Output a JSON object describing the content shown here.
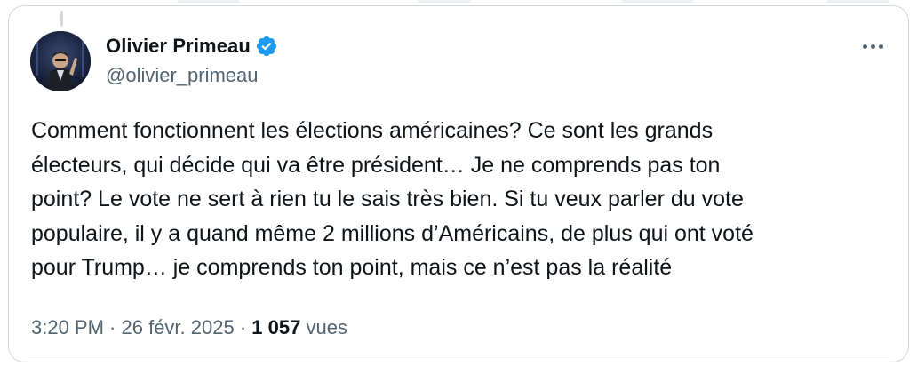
{
  "tweet": {
    "author": {
      "display_name": "Olivier Primeau",
      "handle": "@olivier_primeau",
      "verified_icon": "verified-badge-icon",
      "avatar_icon": "avatar-photo"
    },
    "text": "Comment fonctionnent les élections américaines? Ce sont les grands\nélecteurs, qui décide qui va être président… Je ne comprends pas ton\npoint? Le vote ne sert à rien tu le sais très bien. Si tu veux parler du vote\npopulaire, il y a quand même 2 millions d’Américains, de plus qui ont voté\npour Trump… je comprends ton point, mais ce n’est pas la réalité",
    "meta": {
      "time": "3:20 PM",
      "separator": " · ",
      "date": "26 févr. 2025",
      "separator2": " · ",
      "views_count": "1 057",
      "views_label": " vues"
    },
    "more_icon": "more-options-icon"
  },
  "colors": {
    "text_primary": "#0f1419",
    "text_secondary": "#536471",
    "verified_blue": "#1d9bf0",
    "border": "#cfd9de"
  }
}
